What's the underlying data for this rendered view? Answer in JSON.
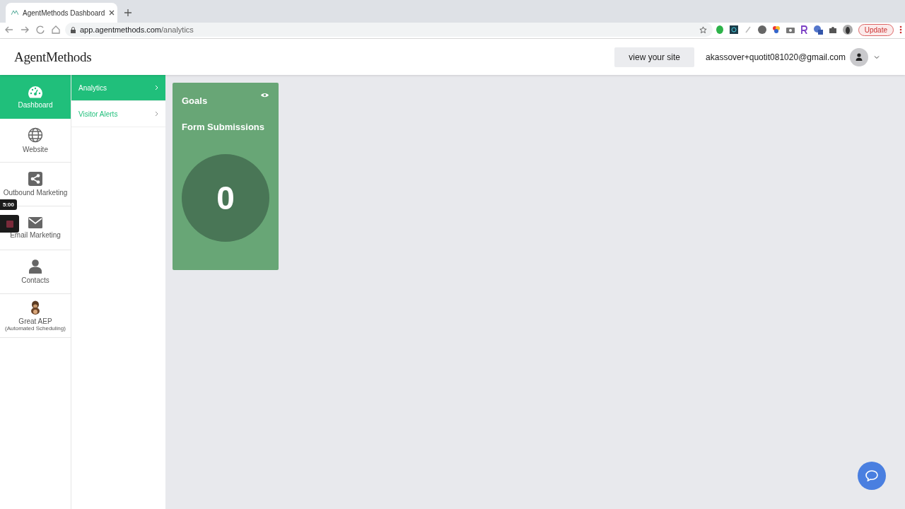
{
  "browser": {
    "tab_title": "AgentMethods Dashboard",
    "url_host": "app.agentmethods.com",
    "url_path": "/analytics",
    "update_button": "Update"
  },
  "header": {
    "logo": "AgentMethods",
    "view_site_button": "view your site",
    "account_email": "akassover+quotit081020@gmail.com"
  },
  "nav": [
    {
      "label": "Dashboard",
      "selected": true
    },
    {
      "label": "Website",
      "selected": false
    },
    {
      "label": "Outbound Marketing",
      "selected": false
    },
    {
      "label": "Email Marketing",
      "selected": false
    },
    {
      "label": "Contacts",
      "selected": false
    },
    {
      "label": "Great AEP",
      "sublabel": "(Automated Scheduling)",
      "selected": false
    }
  ],
  "submenu": [
    {
      "label": "Analytics",
      "selected": true
    },
    {
      "label": "Visitor Alerts",
      "selected": false
    }
  ],
  "cards": [
    {
      "title": "Goals",
      "subtitle": "Form Submissions",
      "value": "0"
    }
  ],
  "recorder": {
    "timer": "5:00"
  }
}
